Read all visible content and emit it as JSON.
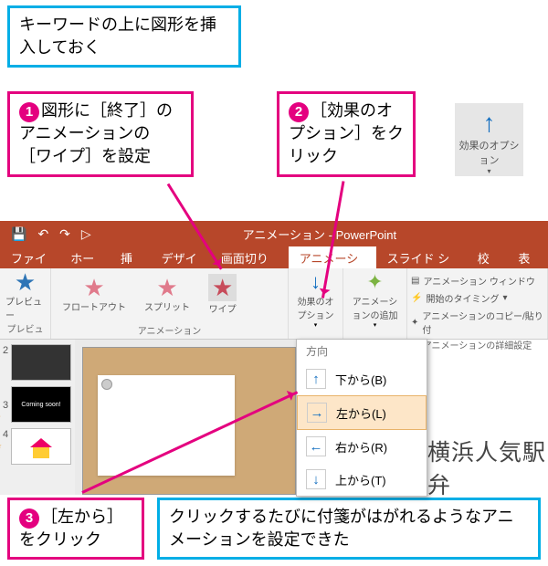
{
  "callouts": {
    "top": "キーワードの上に図形を挿入しておく",
    "step1": "図形に［終了］のアニメーションの［ワイプ］を設定",
    "step2": "［効果のオプション］をクリック",
    "step3": "［左から］をクリック",
    "bottom": "クリックするたびに付箋がはがれるようなアニメーションを設定できた"
  },
  "effopt_big": {
    "label": "効果のオプション"
  },
  "titlebar": {
    "title": "アニメーション - PowerPoint"
  },
  "tabs": [
    "ファイル",
    "ホーム",
    "挿入",
    "デザイン",
    "画面切り替え",
    "アニメーション",
    "スライド ショー",
    "校閲",
    "表示"
  ],
  "ribbon": {
    "preview": "プレビュー",
    "preview_group": "プレビュー",
    "anim_items": [
      "フロートアウト",
      "スプリット",
      "ワイプ"
    ],
    "anim_group": "アニメーション",
    "effopt": "効果のオプション",
    "addanim": "アニメーションの追加",
    "detail": {
      "pane": "アニメーション ウィンドウ",
      "trigger": "開始のタイミング",
      "copy": "アニメーションのコピー/貼り付",
      "group": "アニメーションの詳細設定"
    }
  },
  "dropdown": {
    "header": "方向",
    "items": [
      {
        "label": "下から(B)",
        "dir": "up"
      },
      {
        "label": "左から(L)",
        "dir": "right",
        "selected": true
      },
      {
        "label": "右から(R)",
        "dir": "left"
      },
      {
        "label": "上から(T)",
        "dir": "down"
      }
    ]
  },
  "thumbs": {
    "t3_text": "Coming soon!"
  },
  "slide_text": "横浜人気駅弁"
}
